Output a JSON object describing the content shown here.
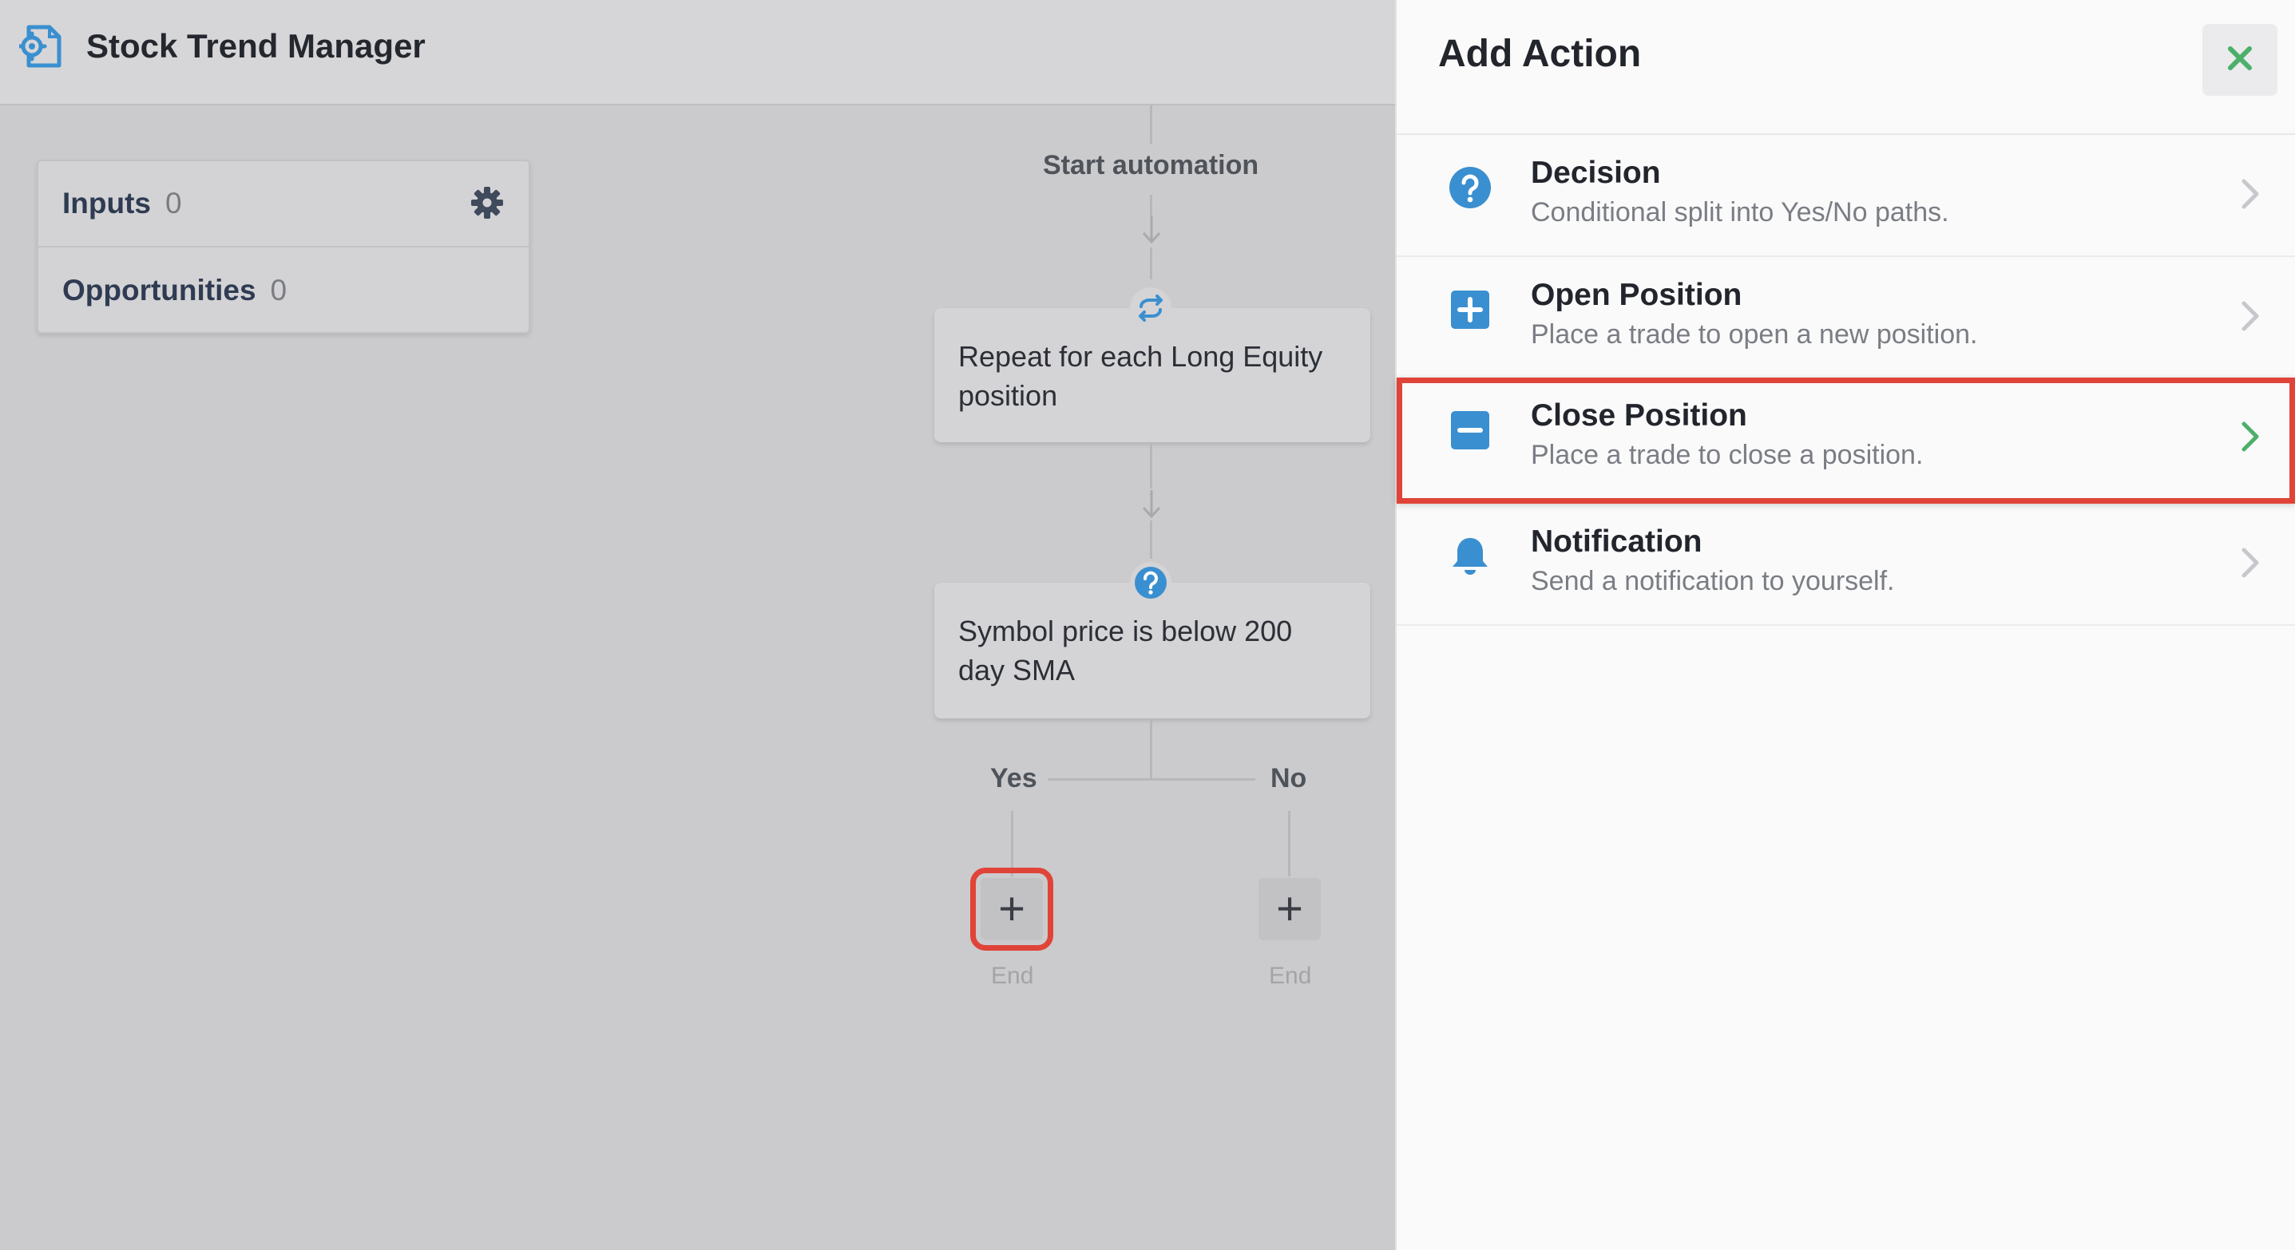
{
  "app": {
    "title": "Stock Trend Manager",
    "logo_icon": "automation-doc-gear-icon",
    "brand_color": "#3a8fd0"
  },
  "left_panel": {
    "items": [
      {
        "label": "Inputs",
        "count": "0",
        "icon": "gear-icon"
      },
      {
        "label": "Opportunities",
        "count": "0"
      }
    ]
  },
  "flow": {
    "start_label": "Start automation",
    "nodes": [
      {
        "icon": "repeat-icon",
        "text": "Repeat for each Long Equity position"
      },
      {
        "icon": "question-circle-icon",
        "text": "Symbol price is below 200 day SMA"
      }
    ],
    "branches": {
      "yes_label": "Yes",
      "no_label": "No",
      "yes_add": "+",
      "no_add": "+",
      "yes_end": "End",
      "no_end": "End"
    }
  },
  "drawer": {
    "title": "Add Action",
    "close_icon": "close-icon",
    "close_color": "#4caf6a",
    "highlight_color": "#e04438",
    "actions": [
      {
        "name": "Decision",
        "description": "Conditional split into Yes/No paths.",
        "icon": "question-circle-icon"
      },
      {
        "name": "Open Position",
        "description": "Place a trade to open a new position.",
        "icon": "plus-square-icon"
      },
      {
        "name": "Close Position",
        "description": "Place a trade to close a position.",
        "icon": "minus-square-icon",
        "selected": true
      },
      {
        "name": "Notification",
        "description": "Send a notification to yourself.",
        "icon": "bell-icon"
      }
    ]
  }
}
